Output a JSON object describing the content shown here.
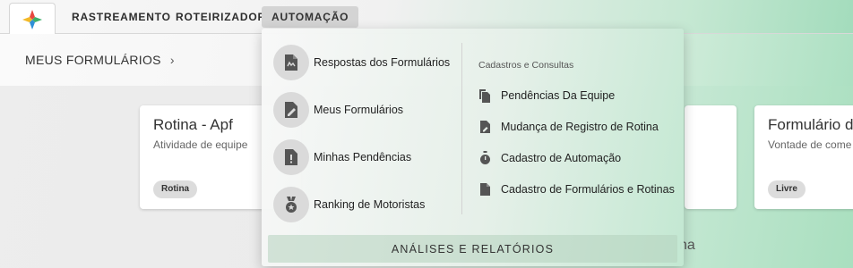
{
  "nav": {
    "items": [
      {
        "label": "RASTREAMENTO"
      },
      {
        "label": "ROTEIRIZADOR"
      },
      {
        "label": "AUTOMAÇÃO"
      }
    ]
  },
  "breadcrumb": {
    "label": "MEUS FORMULÁRIOS"
  },
  "cards": [
    {
      "title": "Rotina - Apf",
      "subtitle": "Atividade de equipe",
      "chip": "Rotina"
    },
    {
      "title": "Formulário d",
      "subtitle": "Vontade de come",
      "chip": "Livre"
    }
  ],
  "section_partial": "na",
  "dropdown": {
    "left_items": [
      {
        "label": "Respostas dos Formulários",
        "icon": "form-response-icon"
      },
      {
        "label": "Meus Formulários",
        "icon": "form-edit-icon"
      },
      {
        "label": "Minhas Pendências",
        "icon": "pending-alert-icon"
      },
      {
        "label": "Ranking de Motoristas",
        "icon": "medal-icon"
      }
    ],
    "right_heading": "Cadastros e Consultas",
    "right_items": [
      {
        "label": "Pendências Da Equipe",
        "icon": "copy-files-icon"
      },
      {
        "label": "Mudança de Registro de Rotina",
        "icon": "file-edit-icon"
      },
      {
        "label": "Cadastro de Automação",
        "icon": "stopwatch-icon"
      },
      {
        "label": "Cadastro de Formulários e Rotinas",
        "icon": "document-icon"
      }
    ],
    "bottom_button": "ANÁLISES E RELATÓRIOS"
  },
  "colors": {
    "logo_red": "#e8473f",
    "logo_green": "#3bb06a",
    "logo_blue": "#2f8fd8",
    "logo_yellow": "#f3b928",
    "icon_gray": "#555555"
  }
}
